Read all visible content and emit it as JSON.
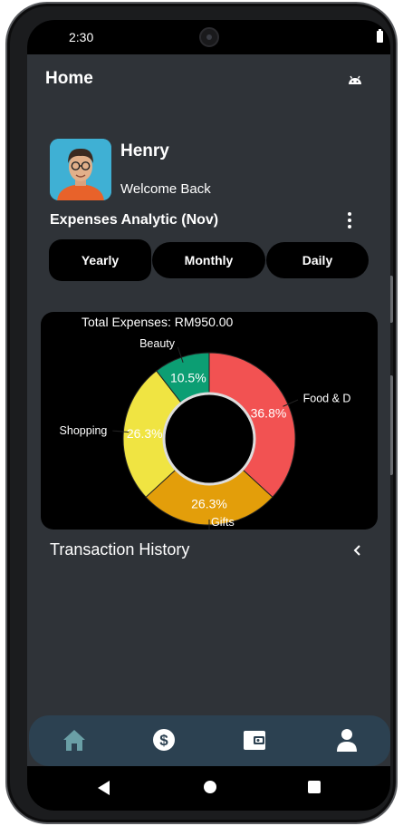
{
  "status_bar": {
    "time": "2:30"
  },
  "app_bar": {
    "title": "Home"
  },
  "profile": {
    "name": "Henry",
    "greeting": "Welcome Back"
  },
  "analytics": {
    "title": "Expenses Analytic (Nov)",
    "tabs": [
      "Yearly",
      "Monthly",
      "Daily"
    ]
  },
  "chart_data": {
    "type": "pie",
    "title": "Total Expenses: RM950.00",
    "donut": true,
    "slices": [
      {
        "label": "Food & D",
        "value": 36.8,
        "value_label": "36.8%",
        "color": "#f25252"
      },
      {
        "label": "Gifts",
        "value": 26.3,
        "value_label": "26.3%",
        "color": "#e39e0a"
      },
      {
        "label": "Shopping",
        "value": 26.3,
        "value_label": "26.3%",
        "color": "#f0e442"
      },
      {
        "label": "Beauty",
        "value": 10.5,
        "value_label": "10.5%",
        "color": "#0c9e73"
      }
    ]
  },
  "transactions": {
    "title": "Transaction History"
  },
  "bottom_nav": {
    "items": [
      {
        "icon": "home-icon",
        "color": "#6a9fa6"
      },
      {
        "icon": "dollar-icon",
        "color": "#ffffff"
      },
      {
        "icon": "wallet-icon",
        "color": "#ffffff"
      },
      {
        "icon": "user-icon",
        "color": "#ffffff"
      }
    ]
  }
}
